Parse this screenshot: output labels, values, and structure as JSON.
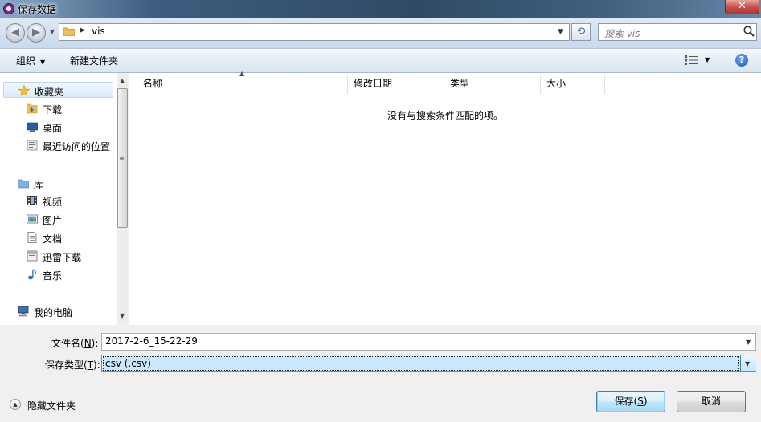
{
  "window": {
    "title": "保存数据",
    "close_label": "✕"
  },
  "nav_buttons": {
    "back_icon": "back-arrow-icon",
    "forward_icon": "forward-arrow-icon"
  },
  "address": {
    "breadcrumb": [
      "vis"
    ]
  },
  "search": {
    "placeholder": "搜索 vis"
  },
  "toolbar": {
    "organize_label": "组织",
    "new_folder_label": "新建文件夹"
  },
  "sidebar": {
    "favorites": {
      "label": "收藏夹",
      "items": [
        {
          "label": "下载",
          "icon": "download-folder-icon"
        },
        {
          "label": "桌面",
          "icon": "desktop-icon"
        },
        {
          "label": "最近访问的位置",
          "icon": "recent-places-icon"
        }
      ]
    },
    "libraries": {
      "label": "库",
      "items": [
        {
          "label": "视频",
          "icon": "video-icon"
        },
        {
          "label": "图片",
          "icon": "pictures-icon"
        },
        {
          "label": "文档",
          "icon": "documents-icon"
        },
        {
          "label": "迅雷下载",
          "icon": "thunder-download-icon"
        },
        {
          "label": "音乐",
          "icon": "music-icon"
        }
      ]
    },
    "computer": {
      "label": "我的电脑"
    }
  },
  "file_list": {
    "columns": [
      "名称",
      "修改日期",
      "类型",
      "大小"
    ],
    "empty_message": "没有与搜索条件匹配的项。"
  },
  "form": {
    "filename_label": "文件名(",
    "filename_key": "N",
    "filename_suffix": "):",
    "filename_value": "2017-2-6_15-22-29",
    "filetype_label": "保存类型(",
    "filetype_key": "T",
    "filetype_suffix": "):",
    "filetype_value": "csv (.csv)"
  },
  "footer": {
    "hide_folders_label": "隐藏文件夹",
    "save_label": "保存(",
    "save_key": "S",
    "save_suffix": ")",
    "cancel_label": "取消"
  }
}
